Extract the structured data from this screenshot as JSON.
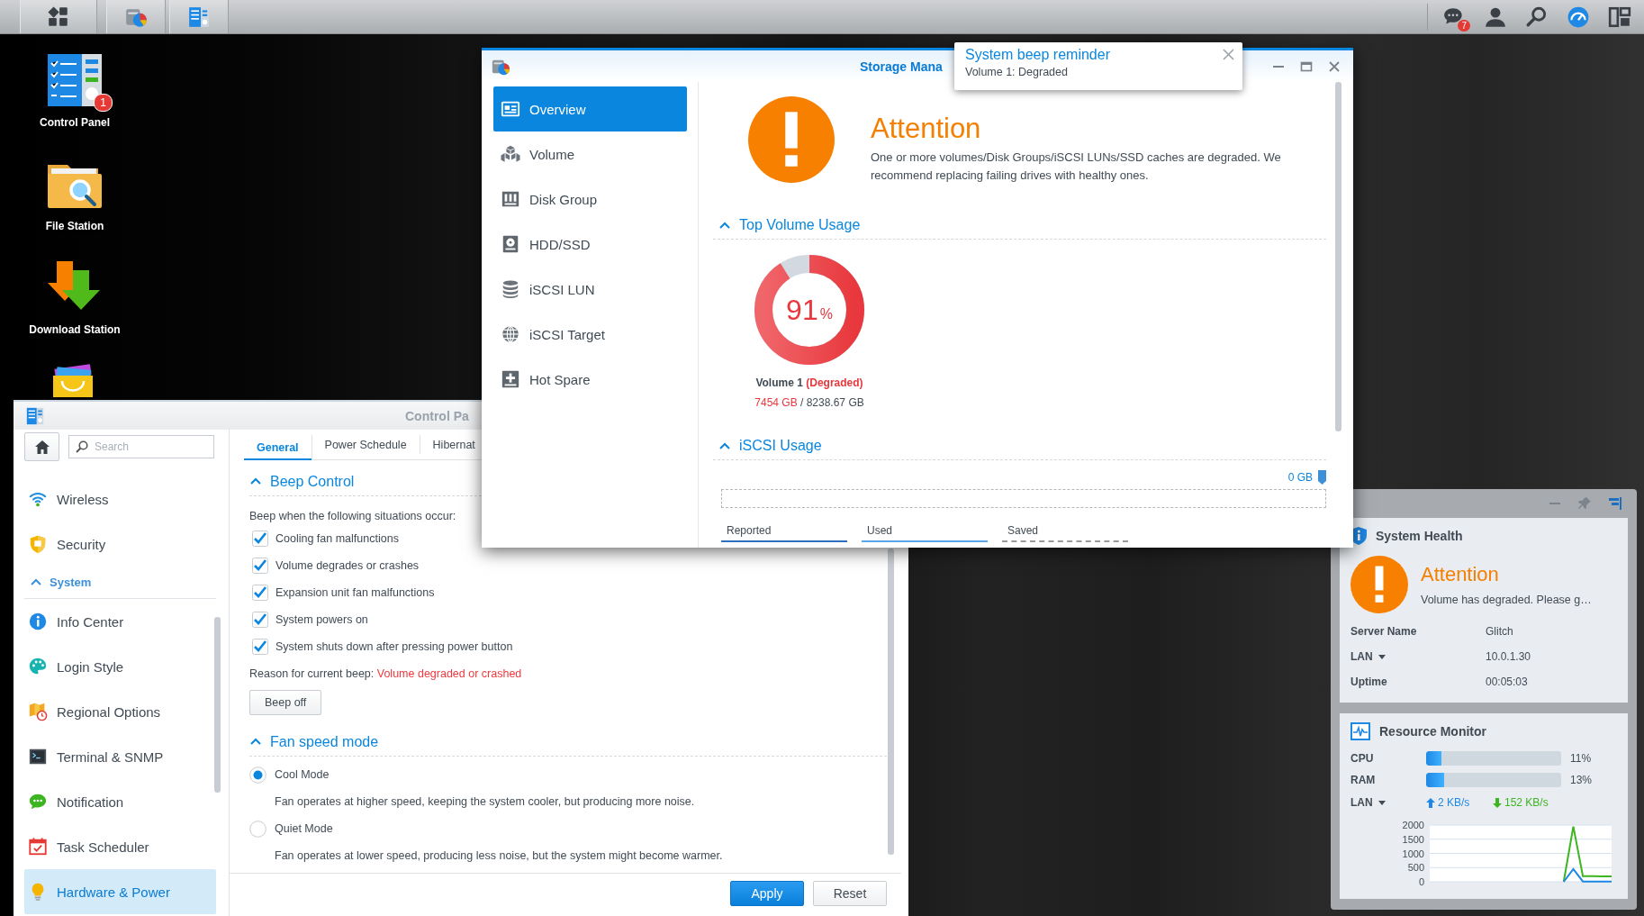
{
  "taskbar": {
    "apps": [
      {
        "kind": "main-menu"
      },
      {
        "kind": "storage"
      },
      {
        "kind": "control-panel"
      }
    ],
    "tray": [
      {
        "kind": "messages",
        "badge": "7"
      },
      {
        "kind": "user"
      },
      {
        "kind": "search"
      },
      {
        "kind": "dashboard"
      },
      {
        "kind": "widgets"
      }
    ]
  },
  "desktop_icons": [
    {
      "kind": "control-panel",
      "label": "Control Panel",
      "badge": "1"
    },
    {
      "kind": "file-station",
      "label": "File Station"
    },
    {
      "kind": "download-station",
      "label": "Download Station"
    },
    {
      "kind": "package-center"
    }
  ],
  "control_panel": {
    "title": "Control Pa",
    "search": {
      "placeholder": "Search"
    },
    "nav": [
      {
        "kind": "wireless",
        "label": "Wireless",
        "selected": false
      },
      {
        "kind": "security",
        "label": "Security",
        "selected": false
      },
      {
        "kind": "section",
        "label": "System",
        "selected": false,
        "expanded": true
      },
      {
        "kind": "info",
        "label": "Info Center",
        "selected": false
      },
      {
        "kind": "login-style",
        "label": "Login Style",
        "selected": false
      },
      {
        "kind": "regional",
        "label": "Regional Options",
        "selected": false
      },
      {
        "kind": "terminal",
        "label": "Terminal & SNMP",
        "selected": false
      },
      {
        "kind": "notification",
        "label": "Notification",
        "selected": false
      },
      {
        "kind": "scheduler",
        "label": "Task Scheduler",
        "selected": false
      },
      {
        "kind": "hardware",
        "label": "Hardware & Power",
        "selected": true
      }
    ],
    "tabs": [
      {
        "label": "General",
        "selected": true
      },
      {
        "label": "Power Schedule",
        "selected": false
      },
      {
        "label": "Hibernat",
        "selected": false
      }
    ],
    "beep_control": {
      "heading": "Beep Control",
      "expanded": true,
      "intro": "Beep when the following situations occur:",
      "options": [
        {
          "label": "Cooling fan malfunctions",
          "checked": true
        },
        {
          "label": "Volume degrades or crashes",
          "checked": true
        },
        {
          "label": "Expansion unit fan malfunctions",
          "checked": true
        },
        {
          "label": "System powers on",
          "checked": true
        },
        {
          "label": "System shuts down after pressing power button",
          "checked": true
        }
      ],
      "reason_label": "Reason for current beep:",
      "reason_value": "Volume degraded or crashed",
      "button": "Beep off"
    },
    "fan_speed": {
      "heading": "Fan speed mode",
      "expanded": true,
      "modes": [
        {
          "label": "Cool Mode",
          "selected": true,
          "description": "Fan operates at higher speed, keeping the system cooler, but producing more noise."
        },
        {
          "label": "Quiet Mode",
          "selected": false,
          "description": "Fan operates at lower speed, producing less noise, but the system might become warmer."
        }
      ]
    },
    "buttons": [
      {
        "kind": "primary",
        "label": "Apply"
      },
      {
        "kind": "secondary",
        "label": "Reset"
      }
    ]
  },
  "storage_manager": {
    "title": "Storage Mana",
    "nav": [
      {
        "kind": "overview",
        "label": "Overview",
        "selected": true
      },
      {
        "kind": "volume",
        "label": "Volume",
        "selected": false
      },
      {
        "kind": "disk-group",
        "label": "Disk Group",
        "selected": false
      },
      {
        "kind": "hdd",
        "label": "HDD/SSD",
        "selected": false
      },
      {
        "kind": "iscsi-lun",
        "label": "iSCSI LUN",
        "selected": false
      },
      {
        "kind": "iscsi-target",
        "label": "iSCSI Target",
        "selected": false
      },
      {
        "kind": "hot-spare",
        "label": "Hot Spare",
        "selected": false
      }
    ],
    "alert": {
      "title": "Attention",
      "message": "One or more volumes/Disk Groups/iSCSI LUNs/SSD caches are degraded. We recommend replacing failing drives with healthy ones."
    },
    "top_volume_usage": {
      "heading": "Top Volume Usage",
      "expanded": true,
      "percent": "91",
      "percent_sign": "%",
      "level": 0.91,
      "volume": "Volume 1",
      "status": "(Degraded)",
      "used": "7454 GB",
      "total": "/ 8238.67 GB"
    },
    "iscsi_usage": {
      "heading": "iSCSI Usage",
      "expanded": true,
      "capacity": "0 GB",
      "legend": [
        {
          "label": "Reported",
          "kind": "solid",
          "color": "#2f6fc0"
        },
        {
          "label": "Used",
          "kind": "solid",
          "color": "#5aa6e8"
        },
        {
          "label": "Saved",
          "kind": "dashed",
          "color": "#9a9a9a"
        }
      ]
    }
  },
  "notification": {
    "title": "System beep reminder",
    "message": "Volume 1: Degraded"
  },
  "widget": {
    "system_health": {
      "title": "System Health",
      "status": "Attention",
      "message": "Volume has degraded. Please g…",
      "rows": [
        {
          "label": "Server Name",
          "dropdown": false,
          "value": "Glitch"
        },
        {
          "label": "LAN",
          "dropdown": true,
          "value": "10.0.1.30"
        },
        {
          "label": "Uptime",
          "dropdown": false,
          "value": "00:05:03"
        }
      ]
    },
    "resource_monitor": {
      "title": "Resource Monitor",
      "meters": [
        {
          "label": "CPU",
          "level": 0.11,
          "reading": "11%"
        },
        {
          "label": "RAM",
          "level": 0.13,
          "reading": "13%"
        }
      ],
      "lan": {
        "label": "LAN",
        "upload": "2 KB/s",
        "download": "152 KB/s"
      },
      "chart_data": {
        "type": "line",
        "grid": true,
        "ylim": [
          0,
          2000
        ],
        "yticks": [
          0,
          500,
          1000,
          1500,
          2000
        ],
        "series": [
          {
            "color": "#3cb521",
            "values": [
              null,
              null,
              null,
              null,
              null,
              null,
              null,
              null,
              null,
              null,
              null,
              null,
              null,
              null,
              0,
              1950,
              200,
              200,
              190,
              190
            ]
          },
          {
            "color": "#1e88e5",
            "values": [
              null,
              null,
              null,
              null,
              null,
              null,
              null,
              null,
              null,
              null,
              null,
              null,
              null,
              null,
              0,
              450,
              10,
              10,
              10,
              10
            ]
          }
        ]
      }
    }
  }
}
